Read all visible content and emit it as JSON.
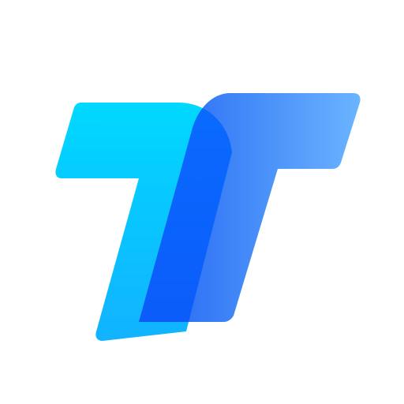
{
  "logo": {
    "icon": "tt-logo-icon",
    "colors": {
      "background": "#ffffff",
      "left_shape_top": "#00D8FF",
      "left_shape_bottom": "#12B2FF",
      "right_shape_start": "#1F62F2",
      "right_shape_end": "#6BB4FF",
      "overlap_start": "#0A6BFF",
      "overlap_end": "#0B5CFA"
    }
  }
}
